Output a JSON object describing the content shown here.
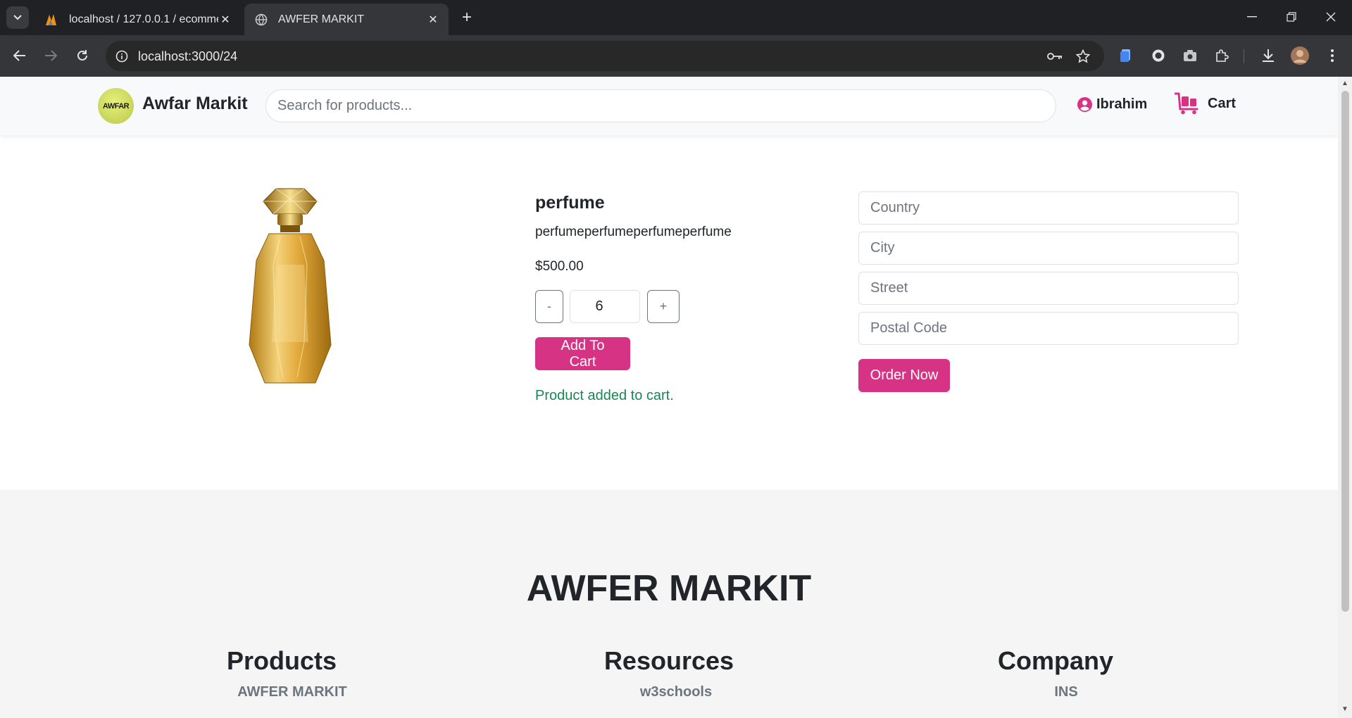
{
  "browser": {
    "tabs": [
      {
        "title": "localhost / 127.0.0.1 / ecommer",
        "icon": "phpmyadmin-icon"
      },
      {
        "title": "AWFER MARKIT",
        "icon": "globe-icon"
      }
    ],
    "url": "localhost:3000/24"
  },
  "header": {
    "logo_text": "AWFAR",
    "brand": "Awfar Markit",
    "search_placeholder": "Search for products...",
    "user": "Ibrahim",
    "cart": "Cart"
  },
  "product": {
    "name": "perfume",
    "description": "perfumeperfumeperfumeperfume",
    "price": "$500.00",
    "quantity": "6",
    "minus": "-",
    "plus": "+",
    "add_to_cart": "Add To Cart",
    "status": "Product added to cart."
  },
  "order_form": {
    "country": "Country",
    "city": "City",
    "street": "Street",
    "postal": "Postal Code",
    "order_now": "Order Now"
  },
  "footer": {
    "title": "AWFER MARKIT",
    "columns": [
      {
        "heading": "Products",
        "link": "AWFER MARKIT"
      },
      {
        "heading": "Resources",
        "link": "w3schools"
      },
      {
        "heading": "Company",
        "link": "INS"
      }
    ]
  },
  "colors": {
    "accent": "#d63384",
    "success": "#198754"
  }
}
